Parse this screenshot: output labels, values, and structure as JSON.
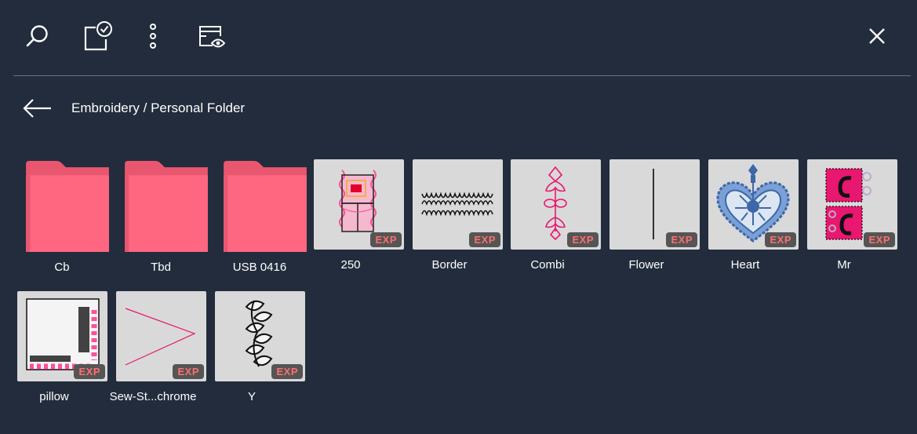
{
  "toolbar": {
    "search": {
      "icon": "search-icon"
    },
    "select": {
      "icon": "select-check-icon"
    },
    "more": {
      "icon": "more-vertical-icon"
    },
    "preview": {
      "icon": "preview-eye-icon"
    },
    "close": {
      "icon": "close-icon"
    }
  },
  "nav": {
    "back_icon": "arrow-left-icon",
    "breadcrumb": "Embroidery / Personal Folder"
  },
  "colors": {
    "background": "#222c3c",
    "folder": "#ff6781",
    "folder_tab": "#e95670",
    "thumb_bg": "#d9d9d9",
    "badge_bg": "#555555",
    "badge_text": "#ff6f6f",
    "divider": "#6c7482"
  },
  "folders": [
    {
      "name": "Cb"
    },
    {
      "name": "Tbd"
    },
    {
      "name": "USB 0416"
    }
  ],
  "files": [
    {
      "name": "250",
      "badge": "EXP"
    },
    {
      "name": "Border",
      "badge": "EXP"
    },
    {
      "name": "Combi",
      "badge": "EXP"
    },
    {
      "name": "Flower",
      "badge": "EXP"
    },
    {
      "name": "Heart",
      "badge": "EXP"
    },
    {
      "name": "Mr",
      "badge": "EXP"
    },
    {
      "name": "pillow",
      "badge": "EXP"
    },
    {
      "name": "Sew-St...chrome",
      "badge": "EXP"
    },
    {
      "name": "Y",
      "badge": "EXP"
    }
  ]
}
